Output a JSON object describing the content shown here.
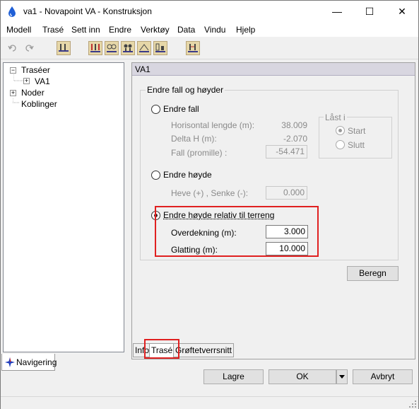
{
  "window": {
    "title": "va1 - Novapoint VA - Konstruksjon",
    "minimize_glyph": "—",
    "maximize_glyph": "☐",
    "close_glyph": "✕"
  },
  "menu": [
    "Modell",
    "Trasé",
    "Sett inn",
    "Endre",
    "Verktøy",
    "Data",
    "Vindu",
    "Hjelp"
  ],
  "tree": {
    "traseer": "Traséer",
    "va1": "VA1",
    "noder": "Noder",
    "koblinger": "Koblinger"
  },
  "nav_tab": "Navigering",
  "panel": {
    "header": "VA1",
    "group_title": "Endre fall og høyder",
    "endre_fall": {
      "label": "Endre fall",
      "horisontal_label": "Horisontal lengde (m):",
      "horisontal_value": "38.009",
      "delta_label": "Delta H (m):",
      "delta_value": "-2.070",
      "fall_label": "Fall (promille) :",
      "fall_value": "-54.471"
    },
    "last": {
      "title": "Låst i",
      "start": "Start",
      "slutt": "Slutt"
    },
    "endre_hoyde": {
      "label": "Endre høyde",
      "heve_label": "Heve (+) , Senke (-):",
      "heve_value": "0.000"
    },
    "relativ": {
      "label": "Endre høyde relativ til terreng",
      "overdekning_label": "Overdekning (m):",
      "overdekning_value": "3.000",
      "glatting_label": "Glatting (m):",
      "glatting_value": "10.000"
    },
    "beregn": "Beregn"
  },
  "tabs": [
    "Info",
    "Trasé",
    "Grøftetverrsnitt"
  ],
  "buttons": {
    "lagre": "Lagre",
    "ok": "OK",
    "avbryt": "Avbryt"
  },
  "colors": {
    "highlight": "#e02020",
    "header_bg": "#d8d6e0",
    "app_icon": "#1f5fd6"
  }
}
